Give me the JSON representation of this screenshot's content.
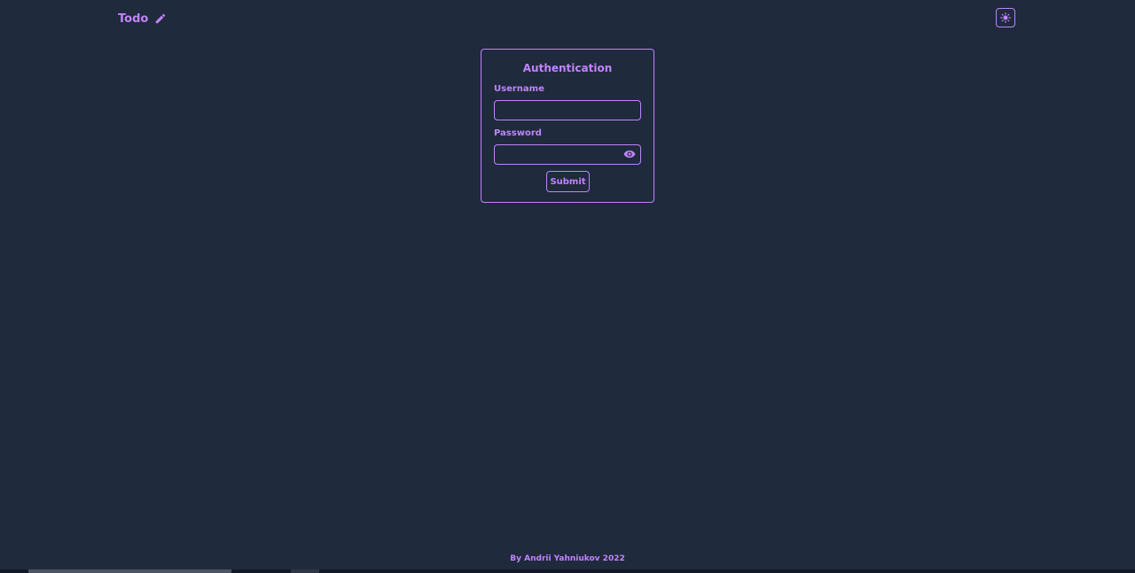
{
  "header": {
    "brand_label": "Todo",
    "brand_icon": "pencil-icon",
    "theme_toggle_icon": "sun-icon"
  },
  "auth": {
    "title": "Authentication",
    "username_label": "Username",
    "username_value": "",
    "password_label": "Password",
    "password_value": "",
    "password_toggle_icon": "eye-icon",
    "submit_label": "Submit"
  },
  "footer": {
    "text": "By Andrii Yahniukov 2022"
  },
  "colors": {
    "background": "#1f2a3c",
    "accent": "#c084fc"
  }
}
